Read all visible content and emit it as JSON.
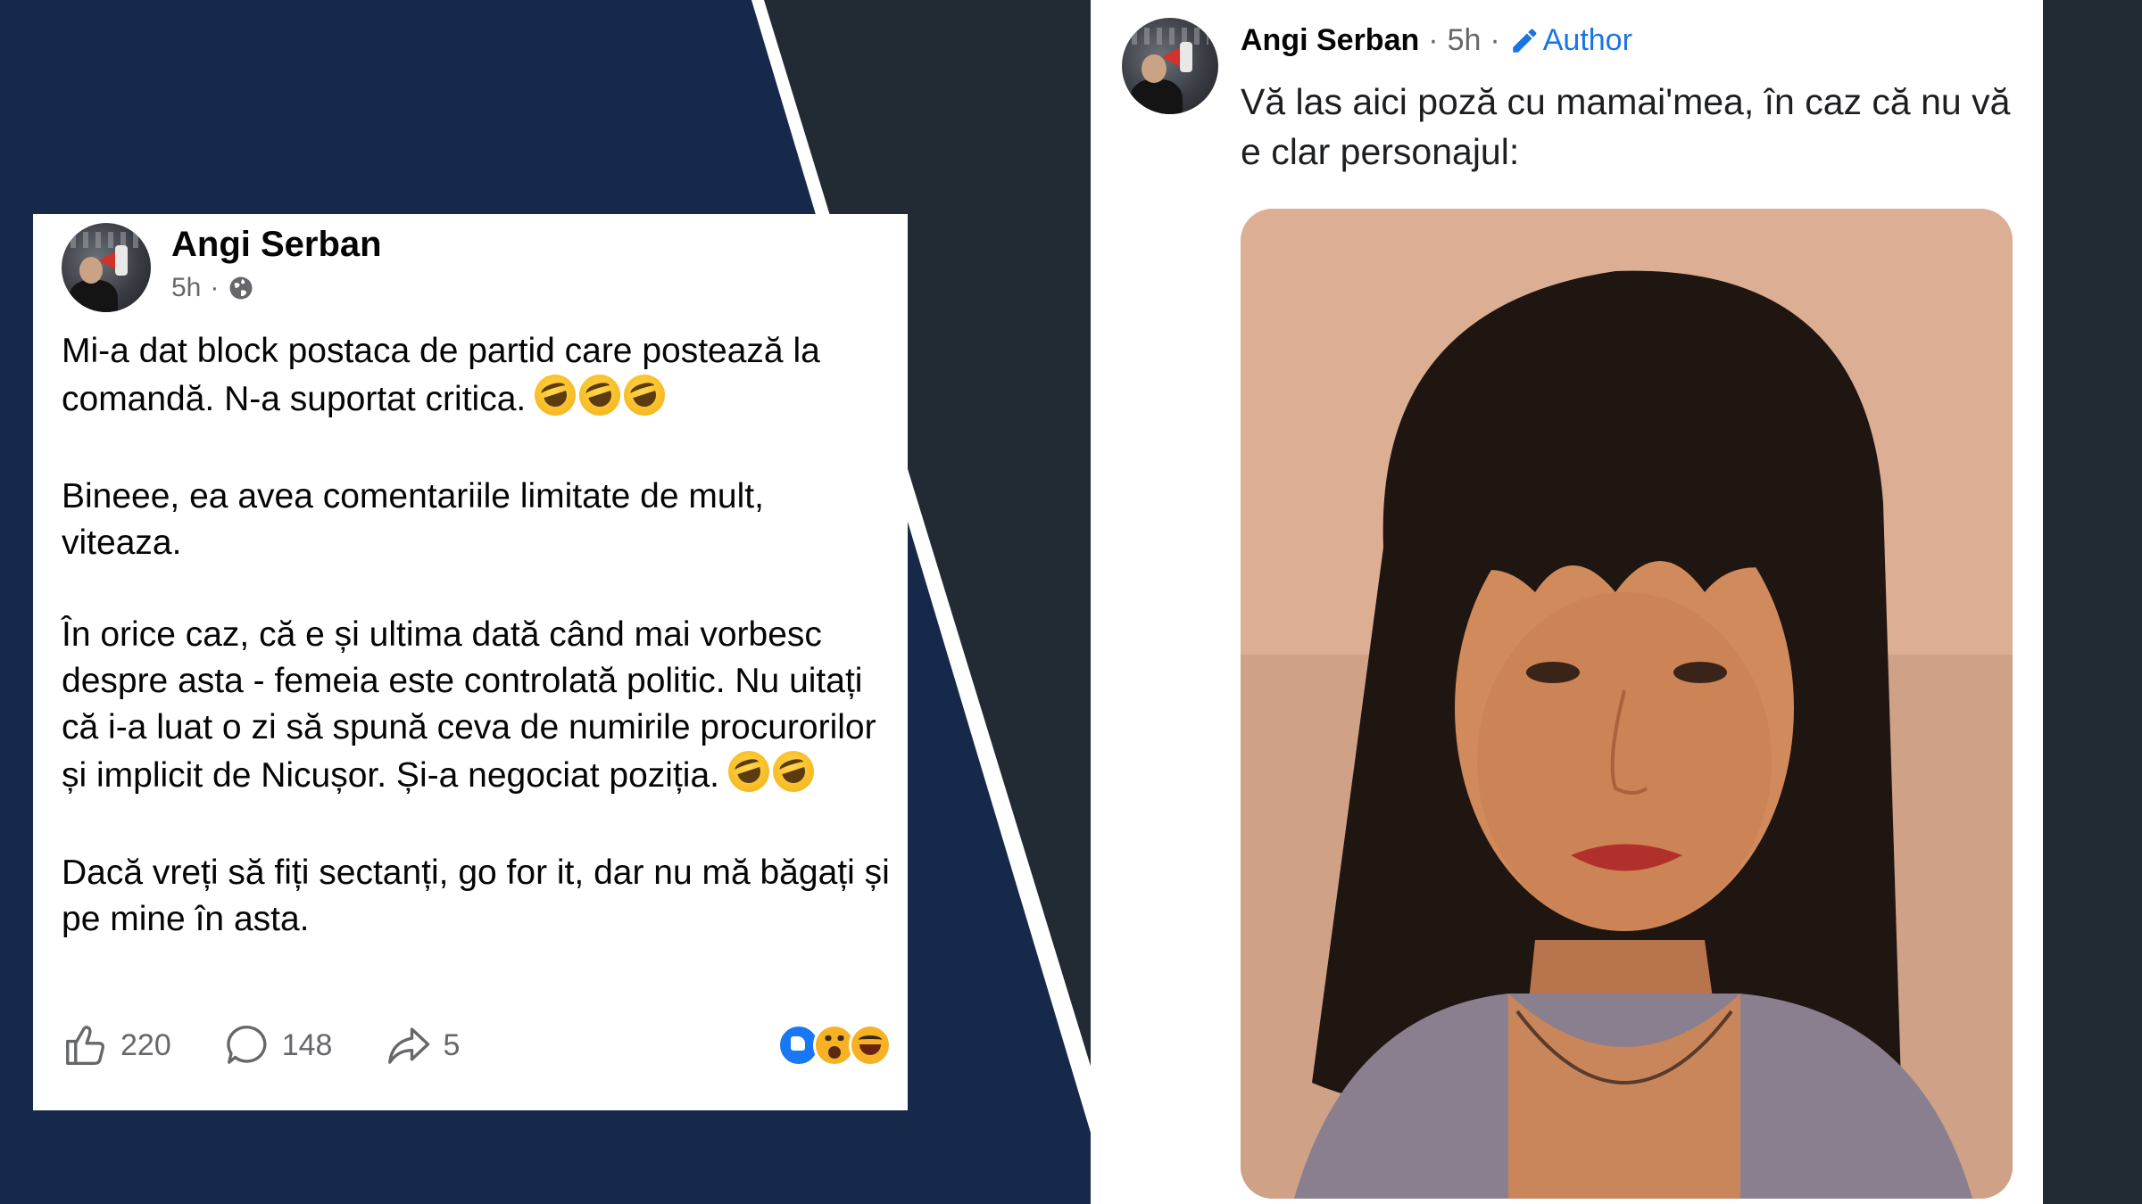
{
  "left_post": {
    "author": "Angi Serban",
    "time": "5h",
    "meta_separator": "·",
    "paragraphs": [
      "Mi-a dat block postaca de partid care postează la comandă. N-a suportat critica.",
      "Bineee, ea avea comentariile limitate de mult, viteaza.",
      "În orice caz, că e și ultima dată când mai vorbesc despre asta - femeia este controlată politic. Nu uitați că i-a luat o zi să spună ceva de numirile procurorilor și implicit de Nicușor. Și-a negociat poziția.",
      "Dacă vreți să fiți sectanți, go for it, dar nu mă băgați și pe mine în asta."
    ],
    "paragraph_emojis": [
      "rolling-laughing",
      "rolling-laughing",
      "rolling-laughing"
    ],
    "paragraph3_emojis": [
      "rolling-laughing",
      "rolling-laughing"
    ],
    "likes": "220",
    "comments": "148",
    "shares": "5",
    "reactions": [
      "like",
      "wow",
      "haha"
    ]
  },
  "right_post": {
    "author": "Angi Serban",
    "separator": "·",
    "time": "5h",
    "badge": "Author",
    "text": "Vă las aici poză cu mamai'mea, în caz că nu vă e clar personajul:"
  },
  "colors": {
    "navy": "#16294a",
    "dark": "#222a33",
    "link_blue": "#1b74e4",
    "like_blue": "#1877f2"
  }
}
